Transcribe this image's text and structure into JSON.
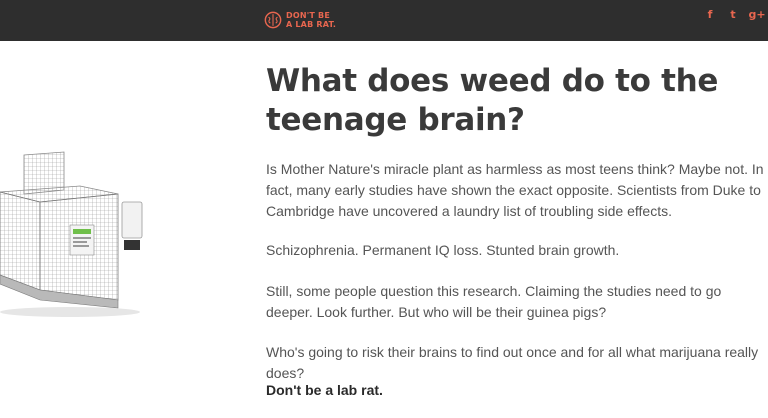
{
  "header": {
    "logo_line1": "DON'T BE",
    "logo_line2": "A LAB RAT.",
    "social": {
      "facebook": "f",
      "twitter": "t",
      "googleplus": "g+"
    }
  },
  "article": {
    "title": "What does weed do to the teenage brain?",
    "paragraphs": [
      "Is Mother Nature's miracle plant as harmless as most teens think? Maybe not. In fact, many early studies have shown the exact opposite. Scientists from Duke to Cambridge have uncovered a laundry list of troubling side effects.",
      "Schizophrenia. Permanent IQ loss. Stunted brain growth.",
      "Still, some people question this research. Claiming the studies need to go deeper. Look further. But who will be their guinea pigs?",
      "Who's going to risk their brains to find out once and for all what marijuana really does?",
      "Don't be a lab rat."
    ]
  },
  "colors": {
    "topbar": "#2e2e2e",
    "accent": "#e8664f",
    "headline": "#3a3a3a",
    "body_text": "#555555"
  },
  "icons": {
    "logo": "brain-icon",
    "cage": "lab-cage-illustration"
  }
}
